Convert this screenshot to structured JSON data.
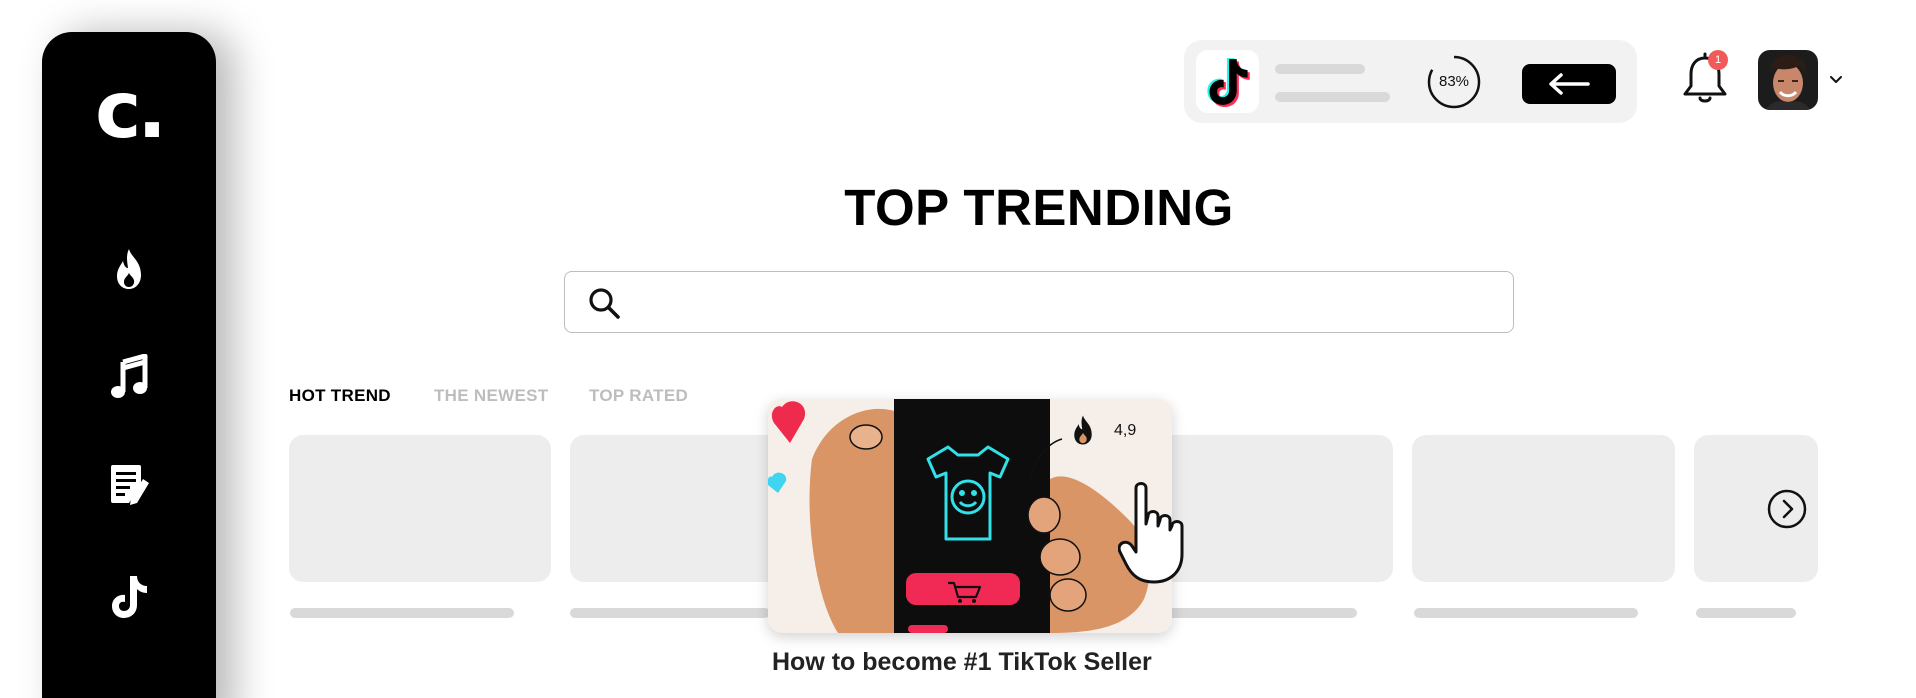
{
  "sidebar": {
    "logo": "c.",
    "items": [
      {
        "icon": "flame-icon"
      },
      {
        "icon": "music-note-icon"
      },
      {
        "icon": "document-edit-icon"
      },
      {
        "icon": "tiktok-icon"
      }
    ]
  },
  "header": {
    "app_icon": "tiktok-logo-icon",
    "progress": {
      "label": "83%",
      "value": 0.83
    },
    "back_icon": "arrow-left-icon",
    "notifications": {
      "icon": "bell-icon",
      "count": "1"
    },
    "avatar": {
      "icon": "user-avatar"
    },
    "chevron": "chevron-down-icon"
  },
  "main": {
    "title": "TOP TRENDING",
    "search": {
      "placeholder": "",
      "value": "",
      "icon": "search-icon"
    },
    "tabs": [
      {
        "label": "HOT TREND",
        "active": true
      },
      {
        "label": "THE NEWEST",
        "active": false
      },
      {
        "label": "TOP RATED",
        "active": false
      }
    ],
    "featured": {
      "title": "How to become #1 TikTok Seller",
      "rating": "4,9",
      "rating_icon": "flame-icon"
    },
    "next_icon": "chevron-right-circle-icon"
  },
  "colors": {
    "sidebar_bg": "#000000",
    "badge": "#f25a5a",
    "placeholder": "#ededed",
    "tiktok_cyan": "#25f4ee",
    "tiktok_red": "#fe2c55"
  }
}
